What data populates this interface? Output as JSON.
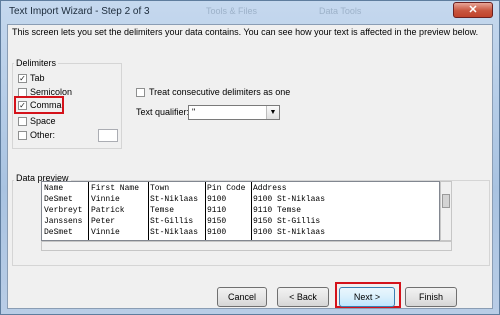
{
  "window": {
    "title": "Text Import Wizard - Step 2 of 3",
    "close_glyph": "✕",
    "background_titles": [
      "Tools & Files",
      "Data Tools"
    ]
  },
  "description": "This screen lets you set the delimiters your data contains.  You can see how your text is affected in the preview below.",
  "delimiters": {
    "label": "Delimiters",
    "options": [
      {
        "label": "Tab",
        "checked": true
      },
      {
        "label": "Semicolon",
        "checked": false
      },
      {
        "label": "Comma",
        "checked": true,
        "highlighted": true
      },
      {
        "label": "Space",
        "checked": false
      },
      {
        "label": "Other:",
        "checked": false,
        "value": ""
      }
    ]
  },
  "options": {
    "treat_consecutive_label": "Treat consecutive delimiters as one",
    "treat_consecutive_checked": false,
    "text_qualifier_label": "Text qualifier:",
    "text_qualifier_value": "\""
  },
  "preview": {
    "label": "Data preview",
    "columns": [
      "Name",
      "First Name",
      "Town",
      "Pin Code",
      "Address"
    ],
    "rows": [
      [
        "DeSmet",
        "Vinnie",
        "St-Niklaas",
        "9100",
        "9100 St-Niklaas"
      ],
      [
        "Verbreyt",
        "Patrick",
        "Temse",
        "9110",
        "9110 Temse"
      ],
      [
        "Janssens",
        "Peter",
        "St-Gillis",
        "9150",
        "9150 St-Gillis"
      ],
      [
        "DeSmet",
        "Vinnie",
        "St-Niklaas",
        "9100",
        "9100 St-Niklaas"
      ]
    ]
  },
  "buttons": {
    "cancel": "Cancel",
    "back": "< Back",
    "next": "Next >",
    "finish": "Finish"
  },
  "colors": {
    "highlight": "#d4121a",
    "close_button": "#c8553e"
  }
}
